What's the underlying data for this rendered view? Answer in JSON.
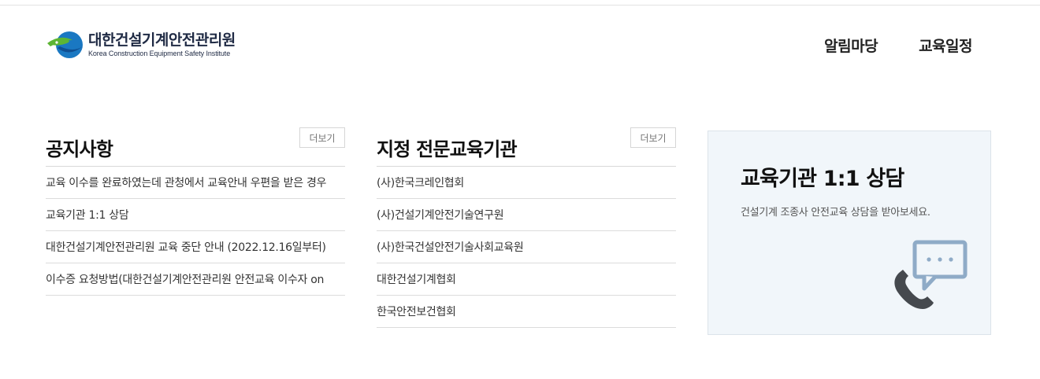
{
  "brand": {
    "name_ko": "대한건설기계안전관리원",
    "name_en": "Korea Construction Equipment Safety Institute"
  },
  "nav": {
    "items": [
      {
        "label": "알림마당"
      },
      {
        "label": "교육일정"
      }
    ]
  },
  "notice": {
    "title": "공지사항",
    "more_label": "더보기",
    "items": [
      {
        "text": "교육 이수를 완료하였는데 관청에서 교육안내 우편을 받은 경우"
      },
      {
        "text": "교육기관 1:1 상담"
      },
      {
        "text": "대한건설기계안전관리원 교육 중단 안내 (2022.12.16일부터)"
      },
      {
        "text": "이수증 요청방법(대한건설기계안전관리원 안전교육 이수자 on"
      }
    ]
  },
  "institutions": {
    "title": "지정 전문교육기관",
    "more_label": "더보기",
    "items": [
      {
        "text": "(사)한국크레인협회"
      },
      {
        "text": "(사)건설기계안전기술연구원"
      },
      {
        "text": "(사)한국건설안전기술사회교육원"
      },
      {
        "text": "대한건설기계협회"
      },
      {
        "text": "한국안전보건협회"
      }
    ]
  },
  "consult": {
    "title": "교육기관 1:1 상담",
    "desc": "건설기계 조종사 안전교육 상담을 받아보세요.",
    "icon": "phone-chat-icon"
  },
  "colors": {
    "logo_blue": "#1a78c2",
    "logo_green": "#5db534",
    "consult_bg": "#f1f6fa",
    "icon_blue": "#8fabc7",
    "icon_dark": "#45494e"
  }
}
